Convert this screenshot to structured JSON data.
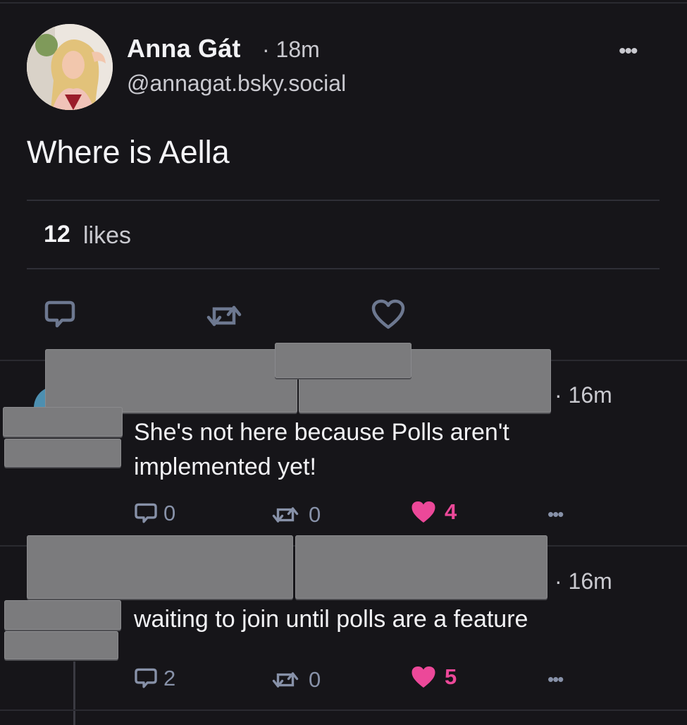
{
  "post": {
    "author_name": "Anna Gát",
    "time": "· 18m",
    "handle": "@annagat.bsky.social",
    "text": "Where is Aella",
    "likes_count": "12",
    "likes_label": "likes",
    "more": "•••"
  },
  "replies": [
    {
      "time": "· 16m",
      "text_line1": "She's not here because Polls aren't",
      "text_line2": "implemented yet!",
      "reply_count": "0",
      "repost_count": "0",
      "like_count": "4",
      "more": "•••"
    },
    {
      "time": "· 16m",
      "text_line1": "waiting to join until polls are a feature",
      "reply_count": "2",
      "repost_count": "0",
      "like_count": "5",
      "more": "•••"
    }
  ],
  "colors": {
    "background": "#161519",
    "icon": "#6d7890",
    "like": "#ec4899"
  }
}
